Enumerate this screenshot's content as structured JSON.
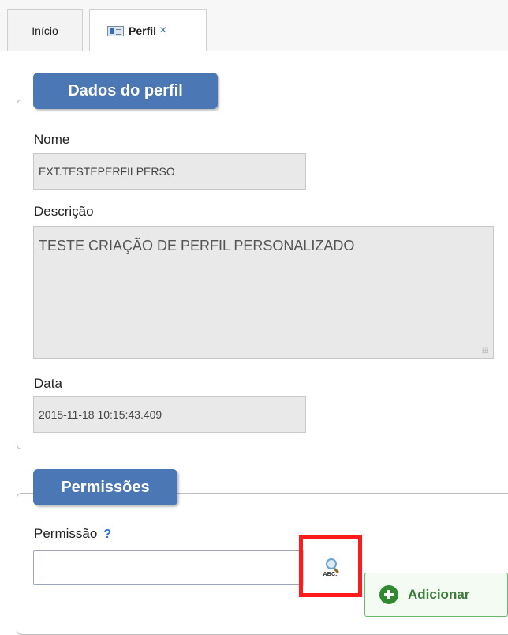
{
  "tabs": {
    "home_label": "Início",
    "profile_label": "Perfil",
    "close_symbol": "×"
  },
  "profile_section": {
    "legend": "Dados do perfil",
    "name_label": "Nome",
    "name_value": "EXT.TESTEPERFILPERSO",
    "description_label": "Descrição",
    "description_value": "TESTE CRIAÇÃO DE PERFIL PERSONALIZADO",
    "date_label": "Data",
    "date_value": "2015-11-18 10:15:43.409"
  },
  "permissions_section": {
    "legend": "Permissões",
    "permission_label": "Permissão",
    "help_symbol": "?",
    "permission_value": "",
    "lookup_icon_text": "ABC..",
    "add_button_label": "Adicionar"
  },
  "colors": {
    "legend_bg": "#4b77b4",
    "highlight_border": "#ff1b1b",
    "add_button_text": "#3a7a3a",
    "help_color": "#2e6fd0"
  }
}
